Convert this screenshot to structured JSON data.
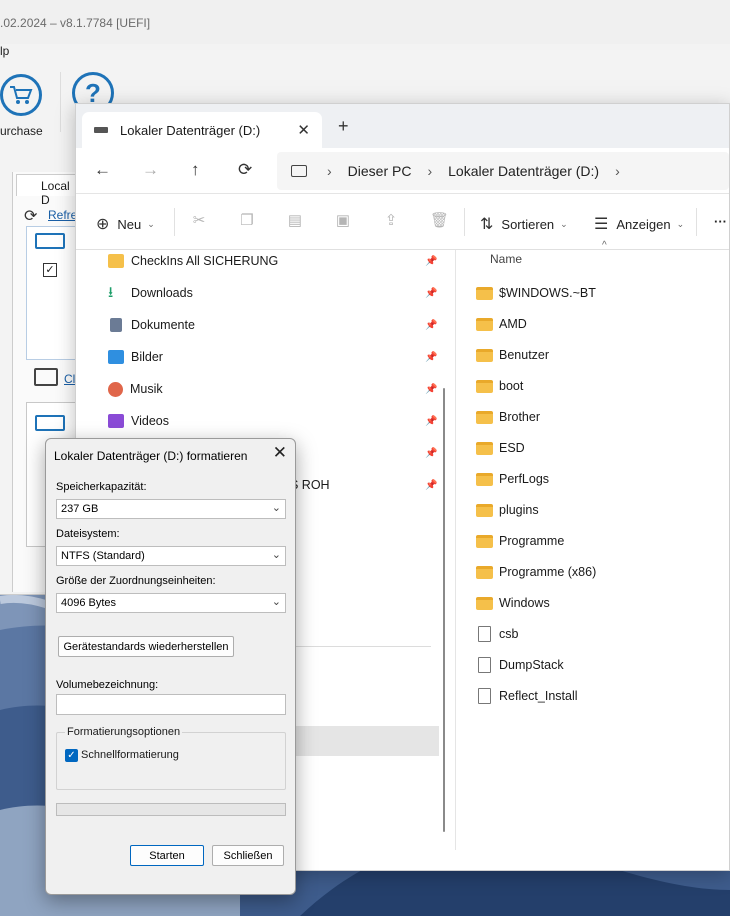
{
  "bgapp": {
    "title": ".02.2024 – v8.1.7784  [UEFI]",
    "menu": "lp",
    "purchase_label": "urchase",
    "help_glyph": "?",
    "local_tab": "Local D",
    "refresh_label": "Refre",
    "cl_label": "Cl"
  },
  "explorer": {
    "tab_title": "Lokaler Datenträger (D:)",
    "tab_close": "✕",
    "tab_new": "+",
    "breadcrumb": [
      "Dieser PC",
      "Lokaler Datenträger (D:)"
    ],
    "cmd": {
      "new_label": "Neu",
      "sort_label": "Sortieren",
      "view_label": "Anzeigen",
      "more": "···"
    },
    "nav_items": [
      {
        "label": "CheckIns All SICHERUNG",
        "color": "#f5c04a"
      },
      {
        "label": "Downloads",
        "color": "#1e9e6a"
      },
      {
        "label": "Dokumente",
        "color": "#6b7b95"
      },
      {
        "label": "Bilder",
        "color": "#2f8fe0"
      },
      {
        "label": "Musik",
        "color": "#e0664a"
      },
      {
        "label": "Videos",
        "color": "#8a4bd6"
      },
      {
        "label": "",
        "color": "#f5c04a"
      },
      {
        "label": "S ROH",
        "color": "#f5c04a"
      }
    ],
    "column_name": "Name",
    "folders": [
      "$WINDOWS.~BT",
      "AMD",
      "Benutzer",
      "boot",
      "Brother",
      "ESD",
      "PerfLogs",
      "plugins",
      "Programme",
      "Programme (x86)",
      "Windows"
    ],
    "files": [
      "csb",
      "DumpStack",
      "Reflect_Install"
    ]
  },
  "dialog": {
    "title": "Lokaler Datenträger (D:) formatieren",
    "close": "✕",
    "capacity_label": "Speicherkapazität:",
    "capacity_value": "237 GB",
    "fs_label": "Dateisystem:",
    "fs_value": "NTFS (Standard)",
    "alloc_label": "Größe der Zuordnungseinheiten:",
    "alloc_value": "4096 Bytes",
    "restore_button": "Gerätestandards wiederherstellen",
    "volume_label": "Volumebezeichnung:",
    "volume_value": "",
    "options_title": "Formatierungsoptionen",
    "quick_format": "Schnellformatierung",
    "quick_format_checked": true,
    "progress": 0,
    "start_button": "Starten",
    "close_button": "Schließen"
  }
}
